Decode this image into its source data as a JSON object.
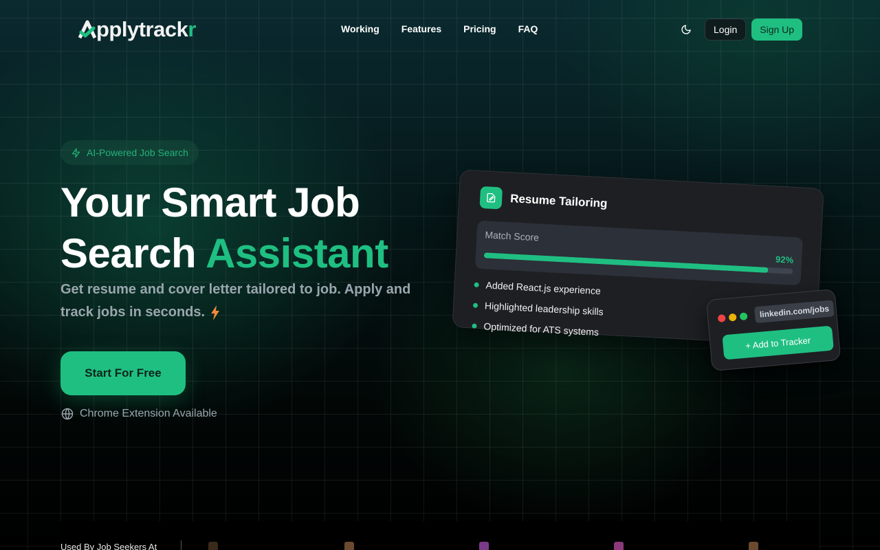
{
  "brand": {
    "name_main": "pplytrack",
    "name_accent": "r",
    "accent_color": "#1fbf82"
  },
  "nav": {
    "links": [
      "Working",
      "Features",
      "Pricing",
      "FAQ"
    ],
    "theme_icon": "moon-icon",
    "login_label": "Login",
    "signup_label": "Sign Up"
  },
  "hero": {
    "badge_icon": "lightning-icon",
    "badge_text": "AI-Powered Job Search",
    "title_line1": "Your Smart Job",
    "title_line2_plain": "Search",
    "title_line2_highlight": "Assistant",
    "subtitle": "Get resume and cover letter tailored to job. Apply and track jobs in seconds.",
    "cta_label": "Start For Free",
    "extension_icon": "globe-icon",
    "extension_text": "Chrome Extension Available"
  },
  "resume_card": {
    "icon": "document-edit-icon",
    "title": "Resume Tailoring",
    "score_label": "Match Score",
    "score_text": "92%",
    "score_fraction": 0.92,
    "points": [
      "Added React.js experience",
      "Highlighted leadership skills",
      "Optimized for ATS systems"
    ]
  },
  "tracker_card": {
    "url": "linkedin.com/jobs",
    "button_label": "+ Add to Tracker",
    "light_colors": [
      "#ef4444",
      "#eab308",
      "#22c55e"
    ]
  },
  "logo_strip": {
    "label": "Used By Job Seekers At"
  }
}
